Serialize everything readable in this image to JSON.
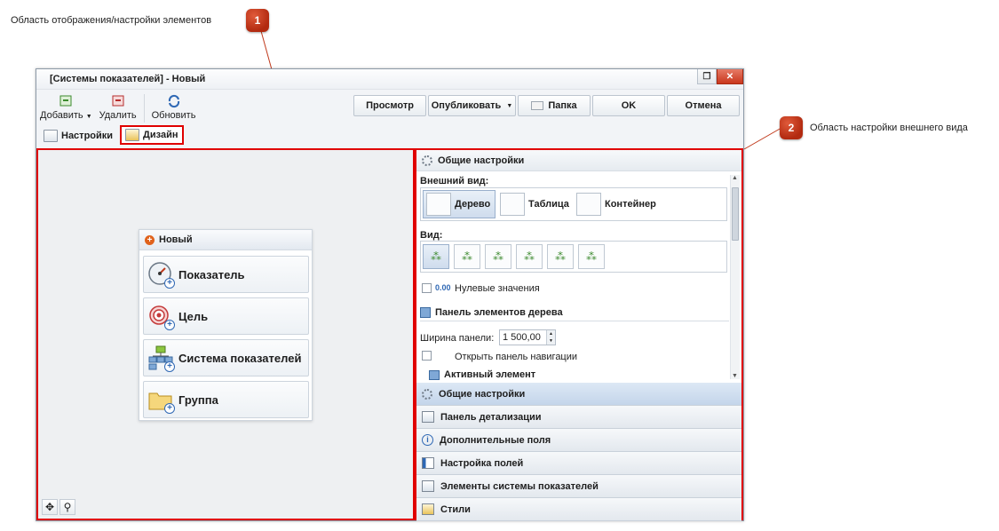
{
  "callouts": [
    {
      "number": "1",
      "text": "Область отображения/настройки элементов"
    },
    {
      "number": "2",
      "text": "Область настройки внешнего вида"
    }
  ],
  "window": {
    "title": "[Системы показателей] - Новый",
    "controls": [
      "restore",
      "close"
    ]
  },
  "toolbar": {
    "add_label": "Добавить",
    "delete_label": "Удалить",
    "refresh_label": "Обновить",
    "preview_label": "Просмотр",
    "publish_label": "Опубликовать",
    "folder_label": "Папка",
    "ok_label": "OK",
    "cancel_label": "Отмена"
  },
  "tabs": [
    {
      "label": "Настройки",
      "active": false
    },
    {
      "label": "Дизайн",
      "active": true
    }
  ],
  "new_panel": {
    "title": "Новый",
    "items": [
      {
        "label": "Показатель",
        "icon": "gauge-icon"
      },
      {
        "label": "Цель",
        "icon": "target-icon"
      },
      {
        "label": "Система показателей",
        "icon": "hierarchy-icon"
      },
      {
        "label": "Группа",
        "icon": "folder-icon"
      }
    ]
  },
  "settings": {
    "header": "Общие настройки",
    "appearance_label": "Внешний вид:",
    "appearance_options": [
      {
        "label": "Дерево",
        "selected": true
      },
      {
        "label": "Таблица",
        "selected": false
      },
      {
        "label": "Контейнер",
        "selected": false
      }
    ],
    "view_label": "Вид:",
    "view_layouts": [
      "tree-down",
      "tree-up",
      "tree-left",
      "tree-right",
      "tree-horizontal",
      "tree-vertical"
    ],
    "zero_values_label": "Нулевые значения",
    "zero_values_badge": "0.00",
    "tree_panel_header": "Панель элементов дерева",
    "panel_width_label": "Ширина панели:",
    "panel_width_value": "1 500,00",
    "open_nav_label": "Открыть панель навигации",
    "active_element_header": "Активный элемент"
  },
  "accordion": [
    {
      "label": "Общие настройки",
      "active": true,
      "icon": "gear-icon"
    },
    {
      "label": "Панель детализации",
      "active": false,
      "icon": "detail-panel-icon"
    },
    {
      "label": "Дополнительные поля",
      "active": false,
      "icon": "info-icon"
    },
    {
      "label": "Настройка полей",
      "active": false,
      "icon": "fields-icon"
    },
    {
      "label": "Элементы системы показателей",
      "active": false,
      "icon": "list-icon"
    },
    {
      "label": "Стили",
      "active": false,
      "icon": "styles-icon"
    }
  ],
  "colors": {
    "highlight": "#e00000",
    "marker": "#c0391b",
    "accent": "#2f68b4"
  }
}
